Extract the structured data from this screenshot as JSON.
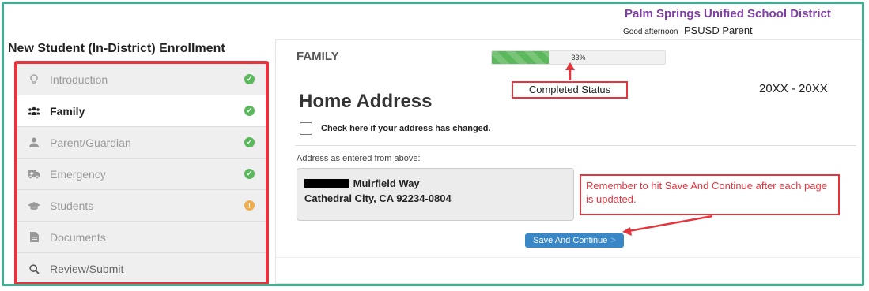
{
  "header": {
    "district_name": "Palm Springs Unified School District",
    "greeting": "Good afternoon",
    "user_name": "PSUSD Parent"
  },
  "page_title": "New Student (In-District) Enrollment",
  "sidebar": {
    "items": [
      {
        "label": "Introduction",
        "icon": "lightbulb-icon",
        "status": "complete",
        "active": false
      },
      {
        "label": "Family",
        "icon": "users-icon",
        "status": "complete",
        "active": true
      },
      {
        "label": "Parent/Guardian",
        "icon": "user-icon",
        "status": "complete",
        "active": false
      },
      {
        "label": "Emergency",
        "icon": "ambulance-icon",
        "status": "complete",
        "active": false
      },
      {
        "label": "Students",
        "icon": "graduation-cap-icon",
        "status": "warning",
        "active": false
      },
      {
        "label": "Documents",
        "icon": "file-icon",
        "status": "none",
        "active": false
      },
      {
        "label": "Review/Submit",
        "icon": "search-icon",
        "status": "none",
        "active": false
      }
    ]
  },
  "main": {
    "section_label": "FAMILY",
    "progress_text": "33%",
    "progress_value": 0.33,
    "heading": "Home Address",
    "year_range": "20XX - 20XX",
    "checkbox_label": "Check here if your address has changed.",
    "address_label": "Address as entered from above:",
    "address_line1": "Muirfield Way",
    "address_line2": "Cathedral City, CA 92234-0804",
    "save_button": "Save And Continue",
    "save_chevron": ">"
  },
  "annotations": {
    "completed_status": "Completed Status",
    "remember": "Remember to hit Save And Continue after each page is updated."
  },
  "colors": {
    "accent_border": "#3fae91",
    "district_purple": "#7d3fa2",
    "highlight_red": "#e4353e",
    "progress_green": "#5cb85c",
    "warning_orange": "#f0ad4e",
    "button_blue": "#3a87c8"
  }
}
